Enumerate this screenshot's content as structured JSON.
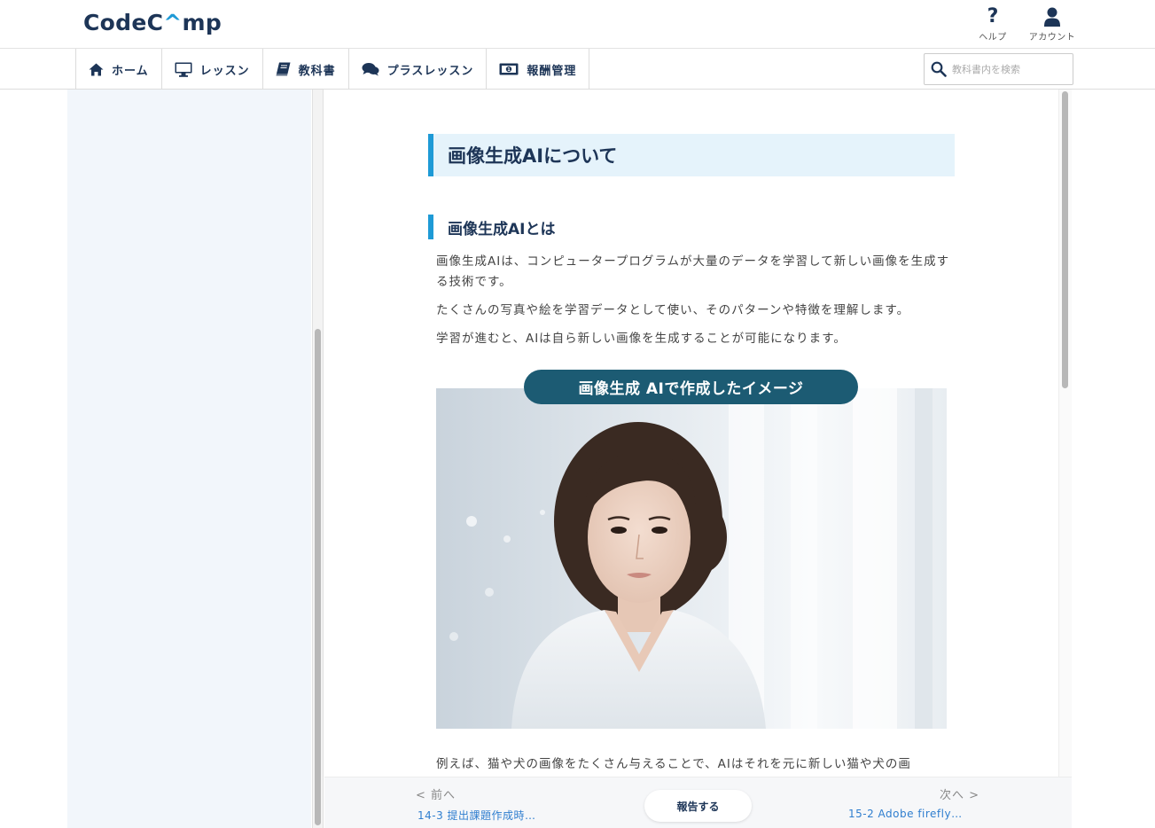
{
  "header": {
    "logo_text_a": "CodeC",
    "logo_caret": "^",
    "logo_text_b": "mp",
    "help_label": "ヘルプ",
    "account_label": "アカウント"
  },
  "nav": {
    "items": [
      {
        "label": "ホーム",
        "icon": "home-icon"
      },
      {
        "label": "レッスン",
        "icon": "monitor-icon"
      },
      {
        "label": "教科書",
        "icon": "book-icon"
      },
      {
        "label": "プラスレッスン",
        "icon": "chat-icon"
      },
      {
        "label": "報酬管理",
        "icon": "money-icon"
      }
    ],
    "search_placeholder": "教科書内を検索"
  },
  "article": {
    "title": "画像生成AIについて",
    "section_title": "画像生成AIとは",
    "paragraph1": "画像生成AIは、コンピュータープログラムが大量のデータを学習して新しい画像を生成する技術です。",
    "paragraph2": "たくさんの写真や絵を学習データとして使い、そのパターンや特徴を理解します。",
    "paragraph3": "学習が進むと、AIは自ら新しい画像を生成することが可能になります。",
    "image_caption": "画像生成 AIで作成したイメージ",
    "paragraph4": "例えば、猫や犬の画像をたくさん与えることで、AIはそれを元に新しい猫や犬の画"
  },
  "footer_nav": {
    "prev_label": "< 前へ",
    "prev_link": "14-3 提出課題作成時…",
    "report_button": "報告する",
    "next_label": "次へ >",
    "next_link": "15-2 Adobe firefly…"
  },
  "colors": {
    "accent": "#1e9ad6",
    "navy": "#1d3557",
    "caption_bg": "#1c5b73",
    "heading_bg": "#e5f3fb"
  }
}
